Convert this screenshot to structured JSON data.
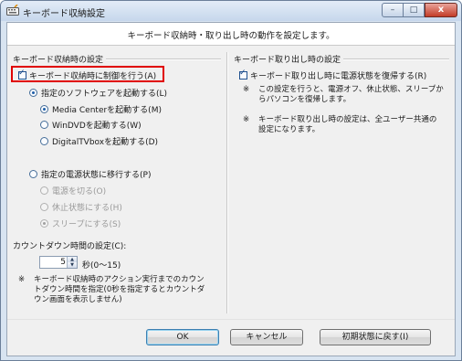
{
  "window": {
    "title": "キーボード収納設定",
    "caption": {
      "min": "–",
      "max": "□",
      "close": "x"
    }
  },
  "banner": "キーボード収納時・取り出し時の動作を設定します。",
  "left_group": {
    "title": "キーボード収納時の設定",
    "control_checkbox": {
      "label": "キーボード収納時に制御を行う(A)",
      "checked": true
    },
    "software_radio": {
      "label": "指定のソフトウェアを起動する(L)",
      "selected": true
    },
    "software_options": [
      {
        "label": "Media Centerを起動する(M)",
        "selected": true
      },
      {
        "label": "WinDVDを起動する(W)",
        "selected": false
      },
      {
        "label": "DigitalTVboxを起動する(D)",
        "selected": false
      }
    ],
    "power_radio": {
      "label": "指定の電源状態に移行する(P)",
      "selected": false
    },
    "power_options": [
      {
        "label": "電源を切る(O)",
        "selected": false
      },
      {
        "label": "休止状態にする(H)",
        "selected": false
      },
      {
        "label": "スリープにする(S)",
        "selected": true
      }
    ],
    "countdown": {
      "label": "カウントダウン時間の設定(C):",
      "value": "5",
      "range": "秒(0〜15)"
    },
    "note": {
      "mark": "※",
      "lines": [
        "キーボード収納時のアクション実行までのカウン",
        "トダウン時間を指定(0秒を指定するとカウントダ",
        "ウン画面を表示しません)"
      ]
    }
  },
  "right_group": {
    "title": "キーボード取り出し時の設定",
    "restore_checkbox": {
      "label": "キーボード取り出し時に電源状態を復帰する(R)",
      "checked": true
    },
    "note1": {
      "mark": "※",
      "lines": [
        "この設定を行うと、電源オフ、休止状態、スリープか",
        "らパソコンを復帰します。"
      ]
    },
    "note2": {
      "mark": "※",
      "lines": [
        "キーボード取り出し時の設定は、全ユーザー共通の",
        "設定になります。"
      ]
    }
  },
  "buttons": {
    "ok": "OK",
    "cancel": "キャンセル",
    "reset": "初期状態に戻す(I)"
  }
}
